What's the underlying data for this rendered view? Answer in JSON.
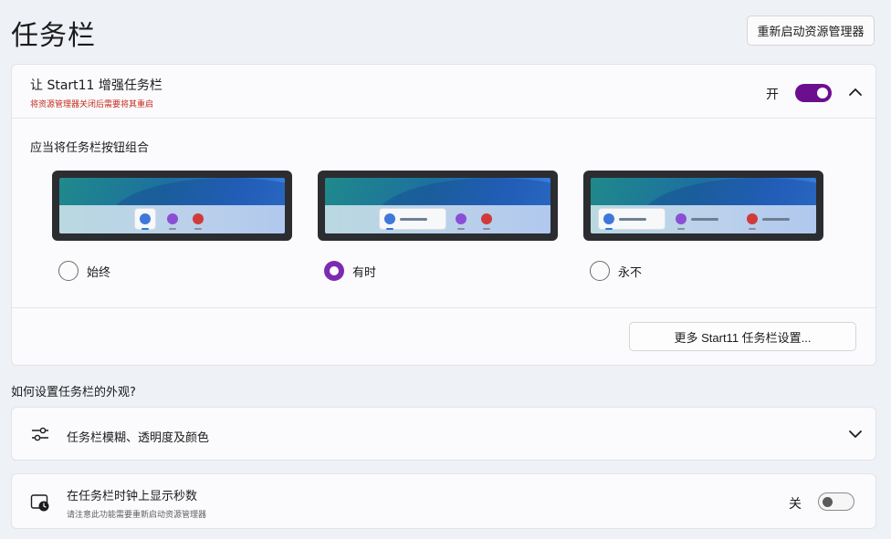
{
  "header": {
    "title": "任务栏",
    "restart_button": "重新启动资源管理器"
  },
  "enhance": {
    "title": "让 Start11 增强任务栏",
    "warning": "将资源管理器关闭后需要将其重启",
    "toggle_label": "开",
    "toggle_state": "on",
    "group_label": "应当将任务栏按钮组合",
    "options": [
      {
        "label": "始终",
        "checked": false
      },
      {
        "label": "有时",
        "checked": true
      },
      {
        "label": "永不",
        "checked": false
      }
    ],
    "more_button": "更多 Start11 任务栏设置..."
  },
  "appearance_question": "如何设置任务栏的外观?",
  "blur_row": {
    "title": "任务栏模糊、透明度及颜色",
    "icon": "sliders-icon"
  },
  "clock_row": {
    "title": "在任务栏时钟上显示秒数",
    "subtitle": "请注意此功能需要重新启动资源管理器",
    "toggle_label": "关",
    "toggle_state": "off",
    "icon": "clock-icon"
  },
  "colors": {
    "accent": "#6b0f8f",
    "warning": "#c42b1c"
  }
}
